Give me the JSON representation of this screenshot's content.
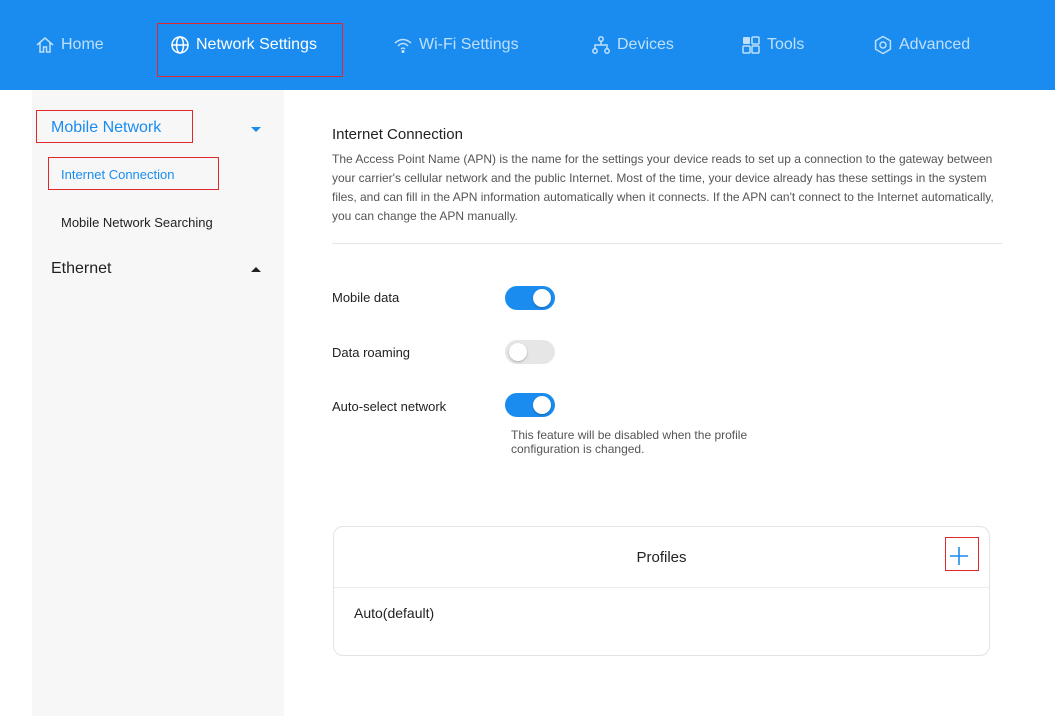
{
  "nav": {
    "home": "Home",
    "network_settings": "Network Settings",
    "wifi_settings": "Wi-Fi Settings",
    "devices": "Devices",
    "tools": "Tools",
    "advanced": "Advanced"
  },
  "sidebar": {
    "mobile_network": "Mobile Network",
    "internet_connection": "Internet Connection",
    "mobile_network_searching": "Mobile Network Searching",
    "ethernet": "Ethernet"
  },
  "main": {
    "title": "Internet Connection",
    "description": "The Access Point Name (APN) is the name for the settings your device reads to set up a connection to the gateway between your carrier's cellular network and the public Internet. Most of the time, your device already has these settings in the system files, and can fill in the APN information automatically when it connects. If the APN can't connect to the Internet automatically, you can change the APN manually.",
    "mobile_data_label": "Mobile data",
    "mobile_data_on": true,
    "data_roaming_label": "Data roaming",
    "data_roaming_on": false,
    "auto_select_label": "Auto-select network",
    "auto_select_on": true,
    "auto_select_hint": "This feature will be disabled when the profile configuration is changed."
  },
  "profiles": {
    "title": "Profiles",
    "items": [
      "Auto(default)"
    ]
  },
  "colors": {
    "accent": "#1a8cf0",
    "highlight": "#e0282e"
  }
}
